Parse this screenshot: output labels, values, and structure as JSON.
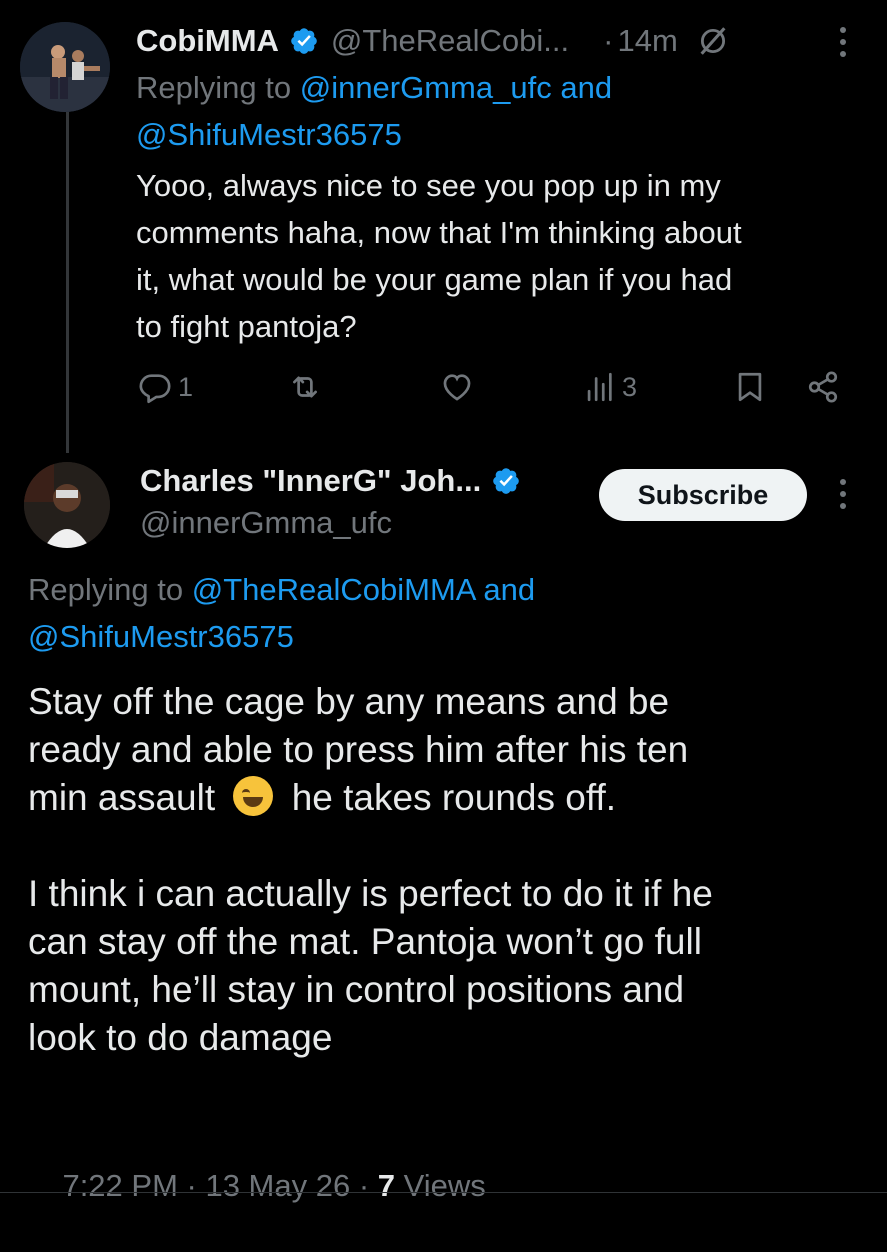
{
  "tweet1": {
    "name": "CobiMMA",
    "handle": "@TheRealCobi...",
    "separator": "·",
    "time": "14m",
    "replying_prefix": "Replying to",
    "replying_user1": "@innerGmma_ufc",
    "replying_and": "and",
    "replying_user2": "@ShifuMestr36575",
    "text_lines": [
      "Yooo, always nice to see you pop up in my",
      "comments haha, now that I'm thinking about",
      "it, what would be your game plan if you had",
      "to fight pantoja?"
    ],
    "reply_count": "1",
    "views_count": "3"
  },
  "tweet2": {
    "name": "Charles \"InnerG\" Joh...",
    "handle": "@innerGmma_ufc",
    "subscribe_label": "Subscribe",
    "replying_prefix": "Replying to",
    "replying_user1": "@TheRealCobiMMA",
    "replying_and": "and",
    "replying_user2": "@ShifuMestr36575",
    "para1_line1": "Stay off the cage by any means and be",
    "para1_line2": "ready and able to press him after his ten",
    "para1_line3_a": "min assault",
    "para1_line3_b": "he takes rounds off.",
    "para2_lines": [
      "I think i can actually is perfect to do it if he",
      "can stay off the mat. Pantoja won’t go full",
      "mount, he’ll stay in control positions and",
      "look to do damage"
    ],
    "timestamp": "7:22 PM · 13 May 26 · ",
    "views_number": "7",
    "views_label": " Views"
  },
  "colors": {
    "background": "#000000",
    "text": "#e7e9ea",
    "muted": "#71767b",
    "accent": "#1d9bf0"
  },
  "icons": [
    "verified-badge-icon",
    "grok-slash-icon",
    "more-icon",
    "reply-icon",
    "retweet-icon",
    "like-icon",
    "views-icon",
    "bookmark-icon",
    "share-icon",
    "laughing-emoji-icon"
  ]
}
